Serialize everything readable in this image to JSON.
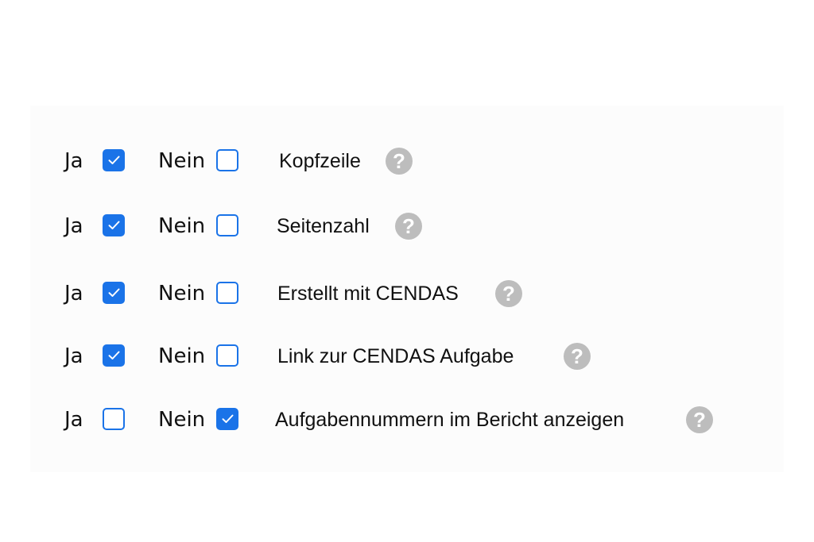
{
  "settings": {
    "rows": [
      {
        "yes_label": "Ja",
        "no_label": "Nein",
        "label": "Kopfzeile",
        "yes_checked": true,
        "no_checked": false
      },
      {
        "yes_label": "Ja",
        "no_label": "Nein",
        "label": "Seitenzahl",
        "yes_checked": true,
        "no_checked": false
      },
      {
        "yes_label": "Ja",
        "no_label": "Nein",
        "label": "Erstellt mit CENDAS",
        "yes_checked": true,
        "no_checked": false
      },
      {
        "yes_label": "Ja",
        "no_label": "Nein",
        "label": "Link zur CENDAS Aufgabe",
        "yes_checked": true,
        "no_checked": false
      },
      {
        "yes_label": "Ja",
        "no_label": "Nein",
        "label": "Aufgabennummern im Bericht anzeigen",
        "yes_checked": false,
        "no_checked": true
      }
    ],
    "help_glyph": "?",
    "help_icon": "question-circle-icon",
    "accent_color": "#1a73e8",
    "help_color": "#bdbdbd"
  }
}
